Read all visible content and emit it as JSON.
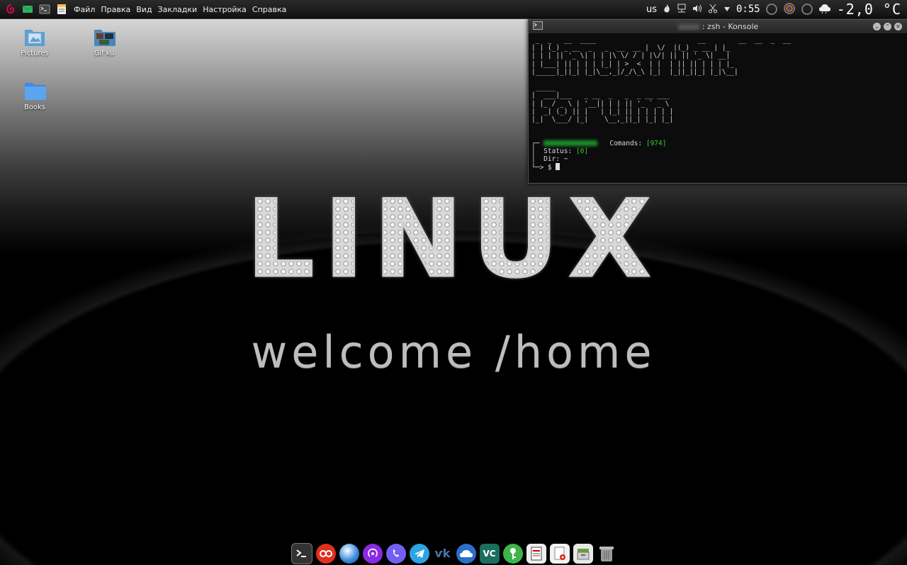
{
  "panel": {
    "menu": [
      "Файл",
      "Правка",
      "Вид",
      "Закладки",
      "Настройка",
      "Справка"
    ],
    "keyboard_layout": "us",
    "clock": "0:55",
    "temperature": "-2,0 °C",
    "icons": [
      "debian-swirl-icon",
      "mail-icon",
      "terminal-icon",
      "notes-icon",
      "flame-icon",
      "network-icon",
      "volume-icon",
      "scissors-icon",
      "dropdown-arrow-icon",
      "cpu-ring-icon",
      "firefox-ring-icon",
      "memory-ring-icon",
      "weather-cloud-icon"
    ]
  },
  "desktop": {
    "icons": [
      {
        "label": "Pictures",
        "icon": "pictures-folder-icon"
      },
      {
        "label": "Gif'ku",
        "icon": "gif-folder-icon"
      },
      {
        "label": "Books",
        "icon": "folder-icon"
      }
    ]
  },
  "wallpaper": {
    "brand": "LINUX",
    "tagline": "welcome /home"
  },
  "konsole": {
    "title": ": zsh - Konsole",
    "ascii_art_1": " _  _   __  ____                         __        __  __  _  __ \n| | (_) _ __  _   _  __  __ |  \\/  |(_) _ __ | |_ \n| | | || '_ \\| | | |\\ \\/ / | |\\/| || || '_ \\| __|\n| |___| || | | | |_| | >  <  | |  | || || | | | |_ \n|_____|_||_| |_|\\__,_|/_/\\_\\ |_|  |_||_||_| |_|\\__|",
    "ascii_art_2": " _____\n|  ___|___   _ __  _   _  _ __ ___  \n| |_ / _ \\ | '__|| | | || '_ ` _ \\ \n|  _| (_) || |   | |_| || | | | | |\n|_|  \\___/ |_|    \\__,_||_| |_| |_|",
    "comands_label": "Comands:",
    "comands_value": "[974]",
    "status_label": "Status:",
    "status_value": "[0]",
    "dir_label": "Dir:",
    "dir_value": "~",
    "prompt": "$"
  },
  "dock": {
    "apps": [
      "terminal-app-icon",
      "pdf-reader-icon",
      "browser-icon",
      "podcast-icon",
      "viber-icon",
      "telegram-icon",
      "vk-icon",
      "cloud-icon",
      "vscode-icon",
      "keepass-icon",
      "text-editor-icon",
      "document-viewer-icon",
      "file-manager-icon",
      "trash-icon"
    ]
  }
}
